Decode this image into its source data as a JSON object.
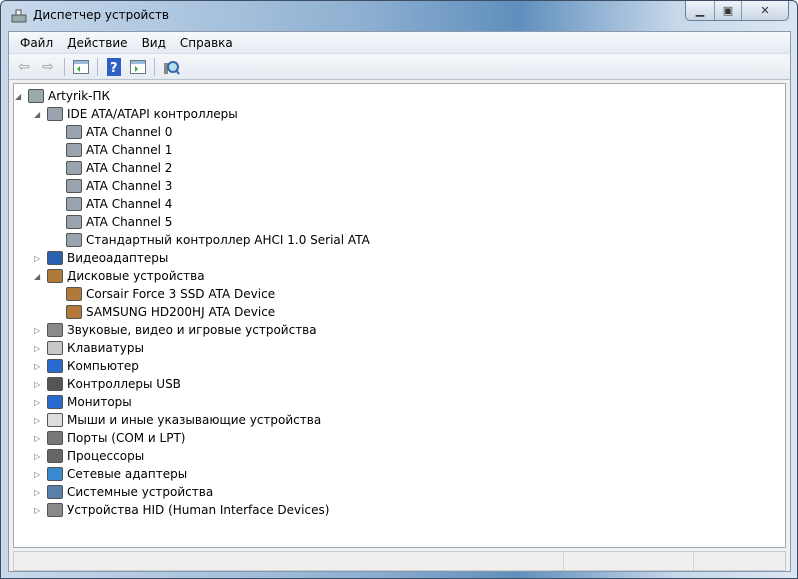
{
  "window": {
    "title": "Диспетчер устройств"
  },
  "menu": [
    "Файл",
    "Действие",
    "Вид",
    "Справка"
  ],
  "toolbar": [
    "back-icon",
    "forward-icon",
    "show-hide-console-tree-icon",
    "help-icon",
    "action-pane-icon",
    "scan-hardware-icon"
  ],
  "tree": {
    "root": "Artyrik-ПК",
    "categories": [
      {
        "label": "IDE ATA/ATAPI контроллеры",
        "expanded": true,
        "icon": "ide-controller",
        "children": [
          "ATA Channel 0",
          "ATA Channel 1",
          "ATA Channel 2",
          "ATA Channel 3",
          "ATA Channel 4",
          "ATA Channel 5",
          "Стандартный контроллер AHCI 1.0 Serial ATA"
        ]
      },
      {
        "label": "Видеоадаптеры",
        "expanded": false,
        "icon": "display-adapter",
        "children": []
      },
      {
        "label": "Дисковые устройства",
        "expanded": true,
        "icon": "disk-drive",
        "children": [
          "Corsair Force 3 SSD ATA Device",
          "SAMSUNG HD200HJ ATA Device"
        ]
      },
      {
        "label": "Звуковые, видео и игровые устройства",
        "expanded": false,
        "icon": "speaker",
        "children": []
      },
      {
        "label": "Клавиатуры",
        "expanded": false,
        "icon": "keyboard",
        "children": []
      },
      {
        "label": "Компьютер",
        "expanded": false,
        "icon": "computer",
        "children": []
      },
      {
        "label": "Контроллеры USB",
        "expanded": false,
        "icon": "usb",
        "children": []
      },
      {
        "label": "Мониторы",
        "expanded": false,
        "icon": "monitor",
        "children": []
      },
      {
        "label": "Мыши и иные указывающие устройства",
        "expanded": false,
        "icon": "mouse",
        "children": []
      },
      {
        "label": "Порты (COM и LPT)",
        "expanded": false,
        "icon": "port",
        "children": []
      },
      {
        "label": "Процессоры",
        "expanded": false,
        "icon": "processor",
        "children": []
      },
      {
        "label": "Сетевые адаптеры",
        "expanded": false,
        "icon": "network",
        "children": []
      },
      {
        "label": "Системные устройства",
        "expanded": false,
        "icon": "system",
        "children": []
      },
      {
        "label": "Устройства HID (Human Interface Devices)",
        "expanded": false,
        "icon": "hid",
        "children": []
      }
    ]
  },
  "colors": {
    "ide-controller": "#9aa4ae",
    "display-adapter": "#2b5fb0",
    "disk-drive": "#b07a3a",
    "speaker": "#8a8a8a",
    "keyboard": "#c8c8c8",
    "computer": "#2a6ad0",
    "usb": "#555555",
    "monitor": "#2a6ad0",
    "mouse": "#dddddd",
    "port": "#777777",
    "processor": "#666666",
    "network": "#3a8ad0",
    "system": "#5a7fa8",
    "hid": "#8a8a8a"
  }
}
